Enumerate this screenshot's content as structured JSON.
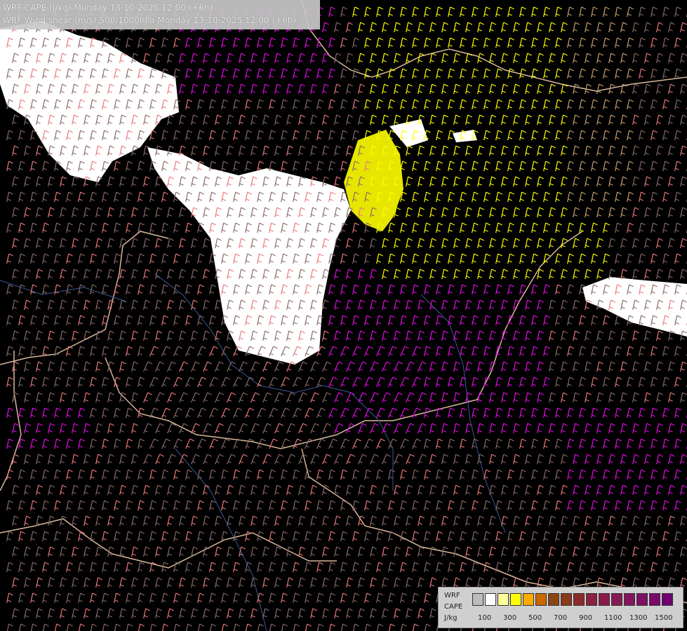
{
  "title": {
    "line1": "WRF CAPE (J/kg) Monday 13-10-2025 12:00 (+6h)",
    "line2": "WRF Wind shear (m/s) 500/1000hPa Monday 13-10-2025 12:00 (+6h)"
  },
  "legend": {
    "model": "WRF",
    "variable": "CAPE",
    "unit": "J/kg",
    "ticks": [
      "100",
      "300",
      "500",
      "700",
      "900",
      "1100",
      "1300",
      "1500"
    ],
    "colors": [
      "#bcbcbc",
      "#ffffff",
      "#ffff99",
      "#ffff00",
      "#ffaa00",
      "#cc6600",
      "#8b4513",
      "#8a3a1a",
      "#8b2a2a",
      "#8b2040",
      "#8a1a4a",
      "#861a55",
      "#85155f",
      "#800f66",
      "#7a0a6a",
      "#700070"
    ]
  },
  "map": {
    "barb_colors": {
      "default": "#8a6a6a",
      "magenta": "#e010e0",
      "yellow": "#ffff00",
      "pink": "#e87a7a",
      "tan": "#c8a070"
    },
    "cape_colors": {
      "white": "#ffffff",
      "yellow": "#ffff00"
    }
  }
}
